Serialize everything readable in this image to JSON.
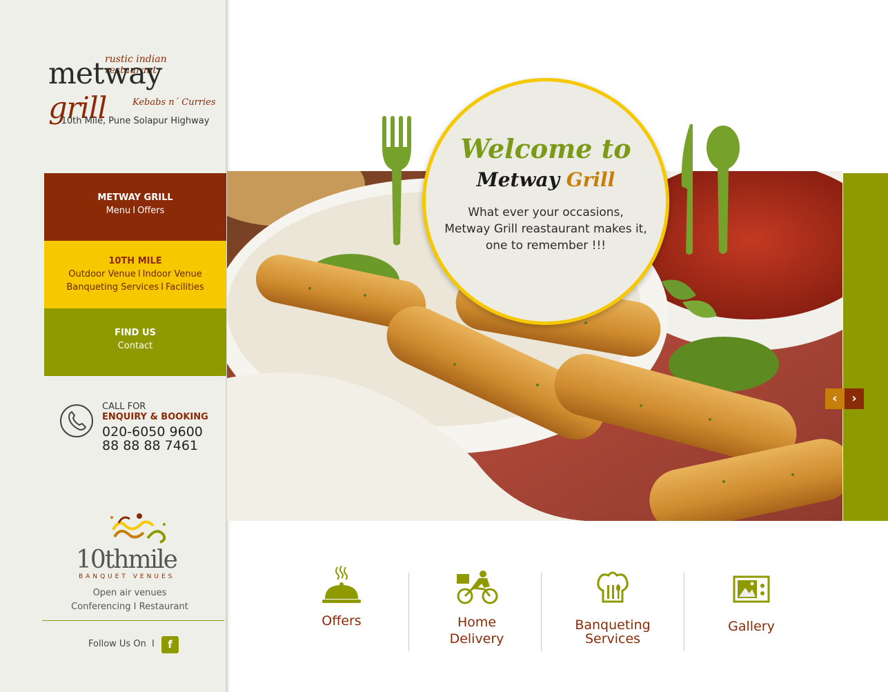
{
  "brand": {
    "tagline": "rustic indian restaurant",
    "name_part1": "metway",
    "name_part2": "grill",
    "subtitle": "Kebabs n´ Curries",
    "address": "10th Mile, Pune Solapur Highway"
  },
  "nav": [
    {
      "head": "METWAY GRILL",
      "line1": [
        "Menu",
        "Offers"
      ]
    },
    {
      "head": "10TH MILE",
      "line1": [
        "Outdoor Venue",
        "Indoor Venue"
      ],
      "line2": [
        "Banqueting Services",
        "Facilities"
      ]
    },
    {
      "head": "FIND US",
      "line1": [
        "Contact"
      ]
    }
  ],
  "separator": "I",
  "contact": {
    "label": "CALL FOR",
    "sublabel": "ENQUIRY & BOOKING",
    "phone1": "020-6050 9600",
    "phone2": "88 88 88 7461"
  },
  "venue": {
    "logo_text": "10thmile",
    "logo_sub": "BANQUET VENUES",
    "line1": "Open air venues",
    "line2": "Conferencing I Restaurant"
  },
  "social": {
    "follow_label": "Follow Us On",
    "sep": "I",
    "facebook_icon": "f"
  },
  "hero": {
    "welcome": "Welcome to",
    "name_part1": "Metway ",
    "name_part2": "Grill",
    "text_line1": "What ever your occasions,",
    "text_line2": "Metway Grill reastaurant makes it,",
    "text_line3": "one to remember !!!",
    "prev": "‹",
    "next": "›"
  },
  "features": [
    {
      "label_line1": "Offers",
      "label_line2": "",
      "icon": "cloche-icon"
    },
    {
      "label_line1": "Home",
      "label_line2": "Delivery",
      "icon": "delivery-bike-icon"
    },
    {
      "label_line1": "Banqueting",
      "label_line2": "Services",
      "icon": "chef-hat-icon"
    },
    {
      "label_line1": "Gallery",
      "label_line2": "",
      "icon": "gallery-icon"
    }
  ],
  "colors": {
    "brown": "#8b2a06",
    "yellow": "#f6c800",
    "olive": "#8e9a00",
    "sidebar_bg": "#efefea"
  }
}
